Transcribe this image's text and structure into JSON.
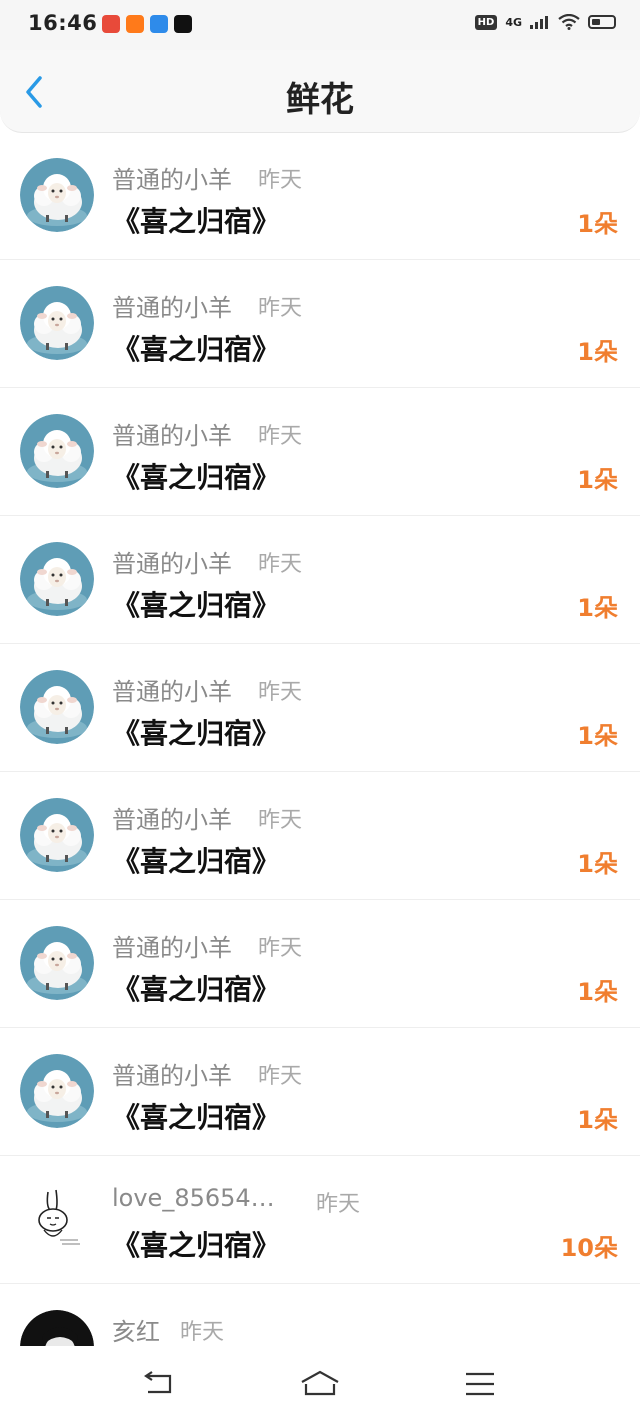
{
  "status_bar": {
    "time": "16:46",
    "hd": "HD",
    "network": "4G"
  },
  "header": {
    "title": "鲜花"
  },
  "rows": [
    {
      "name": "普通的小羊",
      "time": "昨天",
      "work": "《喜之归宿》",
      "count": "1朵",
      "avatar": "sheep-avatar"
    },
    {
      "name": "普通的小羊",
      "time": "昨天",
      "work": "《喜之归宿》",
      "count": "1朵",
      "avatar": "sheep-avatar"
    },
    {
      "name": "普通的小羊",
      "time": "昨天",
      "work": "《喜之归宿》",
      "count": "1朵",
      "avatar": "sheep-avatar"
    },
    {
      "name": "普通的小羊",
      "time": "昨天",
      "work": "《喜之归宿》",
      "count": "1朵",
      "avatar": "sheep-avatar"
    },
    {
      "name": "普通的小羊",
      "time": "昨天",
      "work": "《喜之归宿》",
      "count": "1朵",
      "avatar": "sheep-avatar"
    },
    {
      "name": "普通的小羊",
      "time": "昨天",
      "work": "《喜之归宿》",
      "count": "1朵",
      "avatar": "sheep-avatar"
    },
    {
      "name": "普通的小羊",
      "time": "昨天",
      "work": "《喜之归宿》",
      "count": "1朵",
      "avatar": "sheep-avatar"
    },
    {
      "name": "普通的小羊",
      "time": "昨天",
      "work": "《喜之归宿》",
      "count": "1朵",
      "avatar": "sheep-avatar"
    },
    {
      "name": "love_85654…",
      "time": "昨天",
      "work": "《喜之归宿》",
      "count": "10朵",
      "avatar": "rabbit-avatar"
    },
    {
      "name": "亥红",
      "time": "昨天",
      "work": "",
      "count": "",
      "avatar": "person-avatar"
    }
  ],
  "colors": {
    "accent_back": "#2a9ae6",
    "count": "#f07e2f"
  }
}
